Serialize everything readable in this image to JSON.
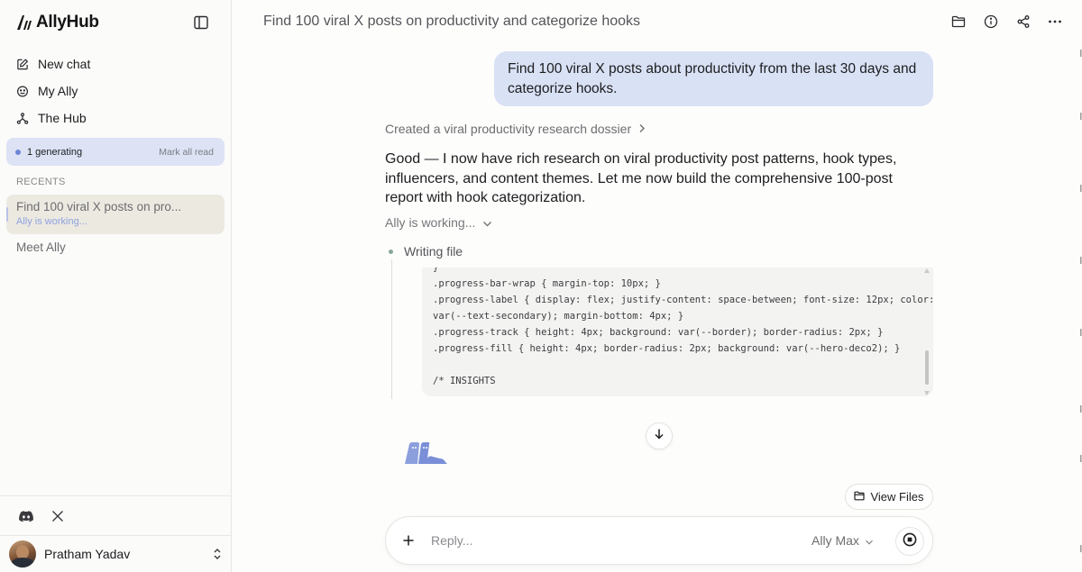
{
  "app": {
    "name": "AllyHub"
  },
  "sidebar": {
    "nav": [
      {
        "label": "New chat",
        "icon": "edit-icon"
      },
      {
        "label": "My Ally",
        "icon": "smile-icon"
      },
      {
        "label": "The Hub",
        "icon": "hub-icon"
      }
    ],
    "generating": {
      "label": "1 generating",
      "action": "Mark all read"
    },
    "recents_label": "RECENTS",
    "recents": [
      {
        "title": "Find 100 viral X posts on pro...",
        "status": "Ally is working..."
      },
      {
        "title": "Meet Ally"
      }
    ],
    "user": {
      "name": "Pratham Yadav"
    }
  },
  "header": {
    "title": "Find 100 viral X posts on productivity and categorize hooks"
  },
  "conversation": {
    "user_message": "Find 100 viral X posts about productivity from the last 30 days and categorize hooks.",
    "artifact_link": "Created a viral productivity research dossier",
    "assistant_message": "Good — I now have rich research on viral productivity post patterns, hook types, influencers, and content themes. Let me now build the comprehensive 100-post report with hook categorization.",
    "working_status": "Ally is working...",
    "step_label": "Writing file",
    "code": "}\n.progress-bar-wrap { margin-top: 10px; }\n.progress-label { display: flex; justify-content: space-between; font-size: 12px; color:\nvar(--text-secondary); margin-bottom: 4px; }\n.progress-track { height: 4px; background: var(--border); border-radius: 2px; }\n.progress-fill { height: 4px; border-radius: 2px; background: var(--hero-deco2); }\n\n/* INSIGHTS"
  },
  "view_files_label": "View Files",
  "composer": {
    "placeholder": "Reply...",
    "model": "Ally Max"
  },
  "colors": {
    "accent": "#6f86d6",
    "user_bubble": "#d9e1f5",
    "generating_bg": "#dde3f5",
    "active_recent_bg": "#ece9e1"
  }
}
